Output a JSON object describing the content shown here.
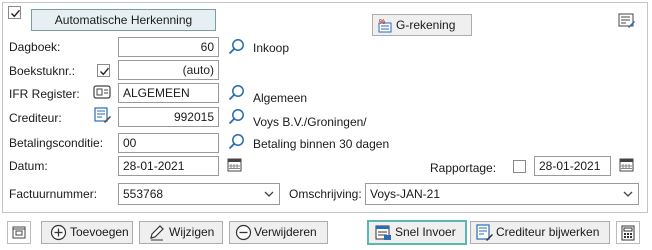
{
  "header": {
    "auto_checkbox_checked": true,
    "auto_button_label": "Automatische Herkenning",
    "g_rekening_label": "G-rekening"
  },
  "fields": {
    "dagboek": {
      "label": "Dagboek:",
      "value": "60",
      "description": "Inkoop"
    },
    "boekstuknr": {
      "label": "Boekstuknr.:",
      "checked": true,
      "value": "(auto)"
    },
    "ifr_register": {
      "label": "IFR Register:",
      "value": "ALGEMEEN",
      "description": "Algemeen"
    },
    "crediteur": {
      "label": "Crediteur:",
      "value": "992015",
      "description": "Voys B.V./Groningen/"
    },
    "betalingsconditie": {
      "label": "Betalingsconditie:",
      "value": "00",
      "description": "Betaling binnen 30 dagen"
    },
    "datum": {
      "label": "Datum:",
      "value": "28-01-2021"
    },
    "rapportage": {
      "label": "Rapportage:",
      "checked": false,
      "value": "28-01-2021"
    },
    "factuurnummer": {
      "label": "Factuurnummer:",
      "value": "553768"
    },
    "omschrijving": {
      "label": "Omschrijving:",
      "value": "Voys-JAN-21"
    }
  },
  "toolbar": {
    "toevoegen": "Toevoegen",
    "wijzigen": "Wijzigen",
    "verwijderen": "Verwijderen",
    "snel_invoer": "Snel Invoer",
    "crediteur_bijwerken": "Crediteur bijwerken"
  },
  "colors": {
    "icon_blue": "#2a6bb3",
    "focus_teal": "#5bb8b0",
    "button_face": "#efefef"
  }
}
